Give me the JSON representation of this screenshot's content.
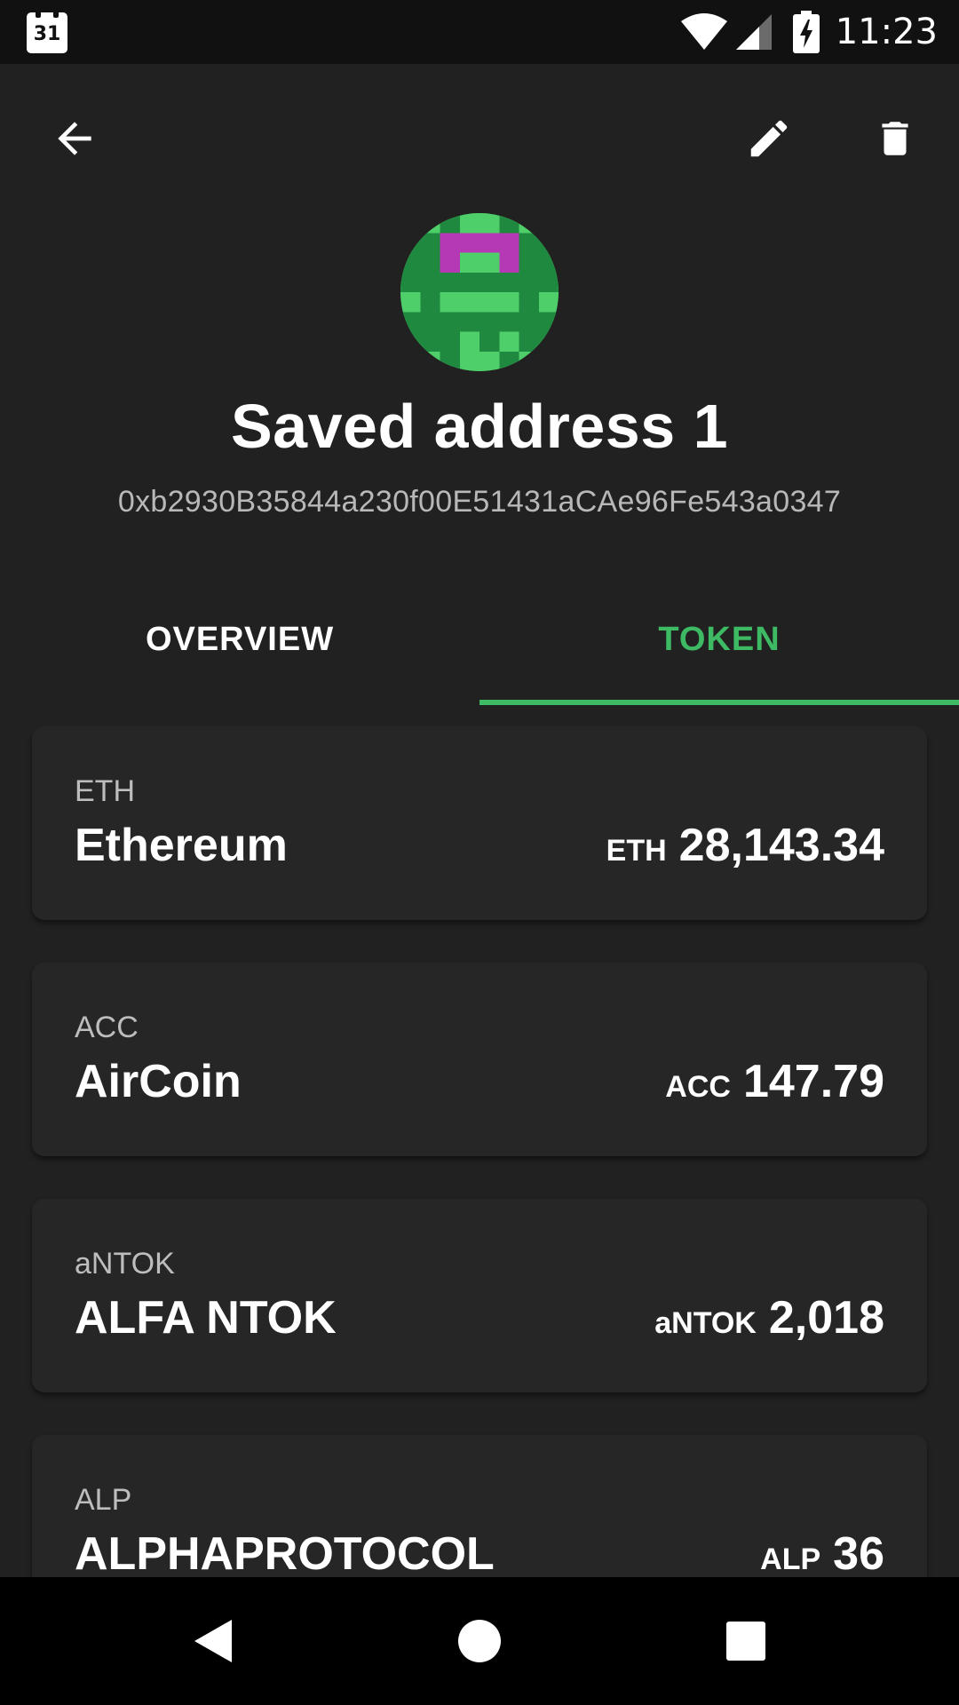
{
  "status_bar": {
    "calendar_day": "31",
    "time": "11:23",
    "icons": [
      "calendar-icon",
      "wifi-icon",
      "signal-icon",
      "battery-charging-icon"
    ]
  },
  "toolbar": {
    "icons": [
      "arrow-back-icon",
      "edit-icon",
      "delete-icon"
    ]
  },
  "profile": {
    "name": "Saved address 1",
    "address": "0xb2930B35844a230f00E51431aCAe96Fe543a0347"
  },
  "tabs": [
    {
      "label": "OVERVIEW",
      "selected": false
    },
    {
      "label": "TOKEN",
      "selected": true
    }
  ],
  "tokens": [
    {
      "symbol": "ETH",
      "name": "Ethereum",
      "unit": "ETH",
      "amount": "28,143.34"
    },
    {
      "symbol": "ACC",
      "name": "AirCoin",
      "unit": "ACC",
      "amount": "147.79"
    },
    {
      "symbol": "aNTOK",
      "name": "ALFA NTOK",
      "unit": "aNTOK",
      "amount": "2,018"
    },
    {
      "symbol": "ALP",
      "name": "ALPHAPROTOCOL",
      "unit": "ALP",
      "amount": "36"
    }
  ],
  "nav_bar": {
    "icons": [
      "nav-back-icon",
      "nav-home-icon",
      "nav-recents-icon"
    ]
  },
  "colors": {
    "background": "#212121",
    "card": "#262626",
    "accent": "#3dba63",
    "avatar_green": "#4fcf6a",
    "avatar_dark_green": "#1f8a3f",
    "avatar_magenta": "#b539b5"
  }
}
